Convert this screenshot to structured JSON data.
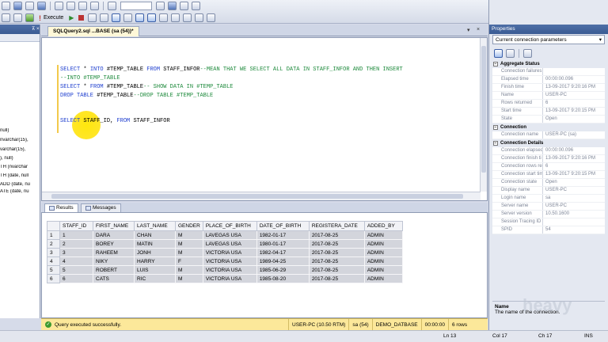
{
  "toolbar": {
    "execute_label": "Execute"
  },
  "object_explorer": {
    "lines": [
      "null)",
      "nvarchar(15),",
      "varchar(15),",
      "), null)",
      "TH (nvarchar",
      "TH (date, null",
      "ADD (date, nu",
      "ATE (date, nu",
      "archar(20), n"
    ]
  },
  "document": {
    "tab_title": "SQLQuery2.sql ...BASE (sa (54))*",
    "code": {
      "line1": {
        "kw1": "SELECT",
        "t1": " * ",
        "kw2": "INTO",
        "t2": " #TEMP_TABLE ",
        "kw3": "FROM",
        "t3": " STAFF_INFOR",
        "comment": "--MEAN THAT WE SELECT ALL DATA IN STAFF_INFOR AND THEN INSERT"
      },
      "line2": {
        "comment": "--INTO #TEMP_TABLE"
      },
      "line3": {
        "kw1": "SELECT",
        "t1": " * ",
        "kw2": "FROM",
        "t2": " #TEMP_TABLE",
        "comment": "-- SHOW DATA IN #TEMP_TABLE"
      },
      "line4": {
        "kw1": "DROP TABLE",
        "t1": " #TEMP_TABLE",
        "comment": "--DROP TABLE #TEMP_TABLE"
      },
      "line5": {
        "kw1": "SELECT",
        "t1": " STAFF_ID,",
        "kw2": "FROM",
        "t2": " STAFF_INFOR"
      }
    }
  },
  "results": {
    "tabs": [
      "Results",
      "Messages"
    ],
    "columns": [
      "STAFF_ID",
      "FIRST_NAME",
      "LAST_NAME",
      "GENDER",
      "PLACE_OF_BIRTH",
      "DATE_OF_BIRTH",
      "REGISTERA_DATE",
      "ADDED_BY"
    ],
    "rows": [
      {
        "n": "1",
        "c": [
          "1",
          "DARA",
          "CHAN",
          "M",
          "LAVEGAS USA",
          "1982-01-17",
          "2017-08-25",
          "ADMIN"
        ]
      },
      {
        "n": "2",
        "c": [
          "2",
          "BOREY",
          "MATIN",
          "M",
          "LAVEGAS USA",
          "1980-01-17",
          "2017-08-25",
          "ADMIN"
        ]
      },
      {
        "n": "3",
        "c": [
          "3",
          "RAHEEM",
          "JONH",
          "M",
          "VICTORIA USA",
          "1982-04-17",
          "2017-08-25",
          "ADMIN"
        ]
      },
      {
        "n": "4",
        "c": [
          "4",
          "NIKY",
          "HARRY",
          "F",
          "VICTORIA USA",
          "1989-04-25",
          "2017-08-25",
          "ADMIN"
        ]
      },
      {
        "n": "5",
        "c": [
          "5",
          "ROBERT",
          "LUIS",
          "M",
          "VICTORIA USA",
          "1985-06-29",
          "2017-08-25",
          "ADMIN"
        ]
      },
      {
        "n": "6",
        "c": [
          "6",
          "CATS",
          "RIC",
          "M",
          "VICTORIA USA",
          "1985-08-20",
          "2017-08-25",
          "ADMIN"
        ]
      }
    ]
  },
  "query_status": {
    "message": "Query executed successfully.",
    "server": "USER-PC (10.50 RTM)",
    "user": "sa (54)",
    "database": "DEMO_DATBASE",
    "elapsed": "00:00:00",
    "rows": "6 rows"
  },
  "properties": {
    "title": "Properties",
    "dropdown": "Current connection parameters",
    "categories": [
      {
        "name": "Aggregate Status",
        "rows": [
          {
            "k": "Connection failures",
            "v": ""
          },
          {
            "k": "Elapsed time",
            "v": "00:00:00.096"
          },
          {
            "k": "Finish time",
            "v": "13-09-2017 9:20:16 PM"
          },
          {
            "k": "Name",
            "v": "USER-PC"
          },
          {
            "k": "Rows returned",
            "v": "6"
          },
          {
            "k": "Start time",
            "v": "13-09-2017 9:20:15 PM"
          },
          {
            "k": "State",
            "v": "Open"
          }
        ]
      },
      {
        "name": "Connection",
        "rows": [
          {
            "k": "Connection name",
            "v": "USER-PC (sa)"
          }
        ]
      },
      {
        "name": "Connection Details",
        "rows": [
          {
            "k": "Connection elapsed",
            "v": "00:00:00.096"
          },
          {
            "k": "Connection finish ti",
            "v": "13-09-2017 9:20:16 PM"
          },
          {
            "k": "Connection rows re",
            "v": "6"
          },
          {
            "k": "Connection start tim",
            "v": "13-09-2017 9:20:15 PM"
          },
          {
            "k": "Connection state",
            "v": "Open"
          },
          {
            "k": "Display name",
            "v": "USER-PC"
          },
          {
            "k": "Login name",
            "v": "sa"
          },
          {
            "k": "Server name",
            "v": "USER-PC"
          },
          {
            "k": "Server version",
            "v": "10.50.1600"
          },
          {
            "k": "Session Tracing ID",
            "v": ""
          },
          {
            "k": "SPID",
            "v": "54"
          }
        ]
      }
    ],
    "desc_name": "Name",
    "desc_text": "The name of the connection.",
    "watermark": "heavy"
  },
  "statusbar": {
    "ln": "Ln 13",
    "col": "Col 17",
    "ch": "Ch 17",
    "mode": "INS"
  }
}
